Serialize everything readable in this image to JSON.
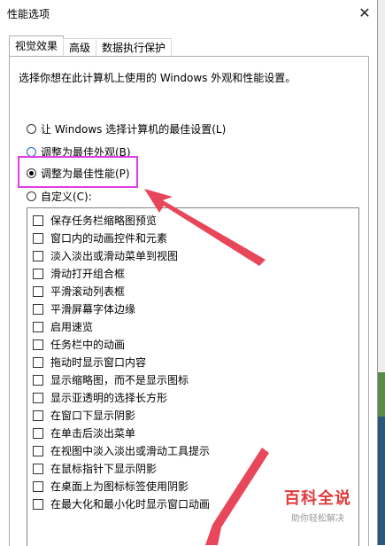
{
  "window": {
    "title": "性能选项",
    "close_glyph": "✕"
  },
  "tabs": [
    {
      "label": "视觉效果",
      "active": true
    },
    {
      "label": "高级",
      "active": false
    },
    {
      "label": "数据执行保护",
      "active": false
    }
  ],
  "description": "选择你想在此计算机上使用的 Windows 外观和性能设置。",
  "radios": [
    {
      "label": "让 Windows 选择计算机的最佳设置(L)",
      "checked": false
    },
    {
      "label": "调整为最佳外观(B)",
      "checked": false
    },
    {
      "label": "调整为最佳性能(P)",
      "checked": true
    },
    {
      "label": "自定义(C):",
      "checked": false
    }
  ],
  "options": [
    "保存任务栏缩略图预览",
    "窗口内的动画控件和元素",
    "淡入淡出或滑动菜单到视图",
    "滑动打开组合框",
    "平滑滚动列表框",
    "平滑屏幕字体边缘",
    "启用速览",
    "任务栏中的动画",
    "拖动时显示窗口内容",
    "显示缩略图，而不是显示图标",
    "显示亚透明的选择长方形",
    "在窗口下显示阴影",
    "在单击后淡出菜单",
    "在视图中淡入淡出或滑动工具提示",
    "在鼠标指针下显示阴影",
    "在桌面上为图标标签使用阴影",
    "在最大化和最小化时显示窗口动画"
  ],
  "watermark": {
    "main": "百科全说",
    "sub": "助你轻松解决"
  },
  "colors": {
    "highlight_box": "#e13ce6",
    "arrow": "#e8475a"
  }
}
